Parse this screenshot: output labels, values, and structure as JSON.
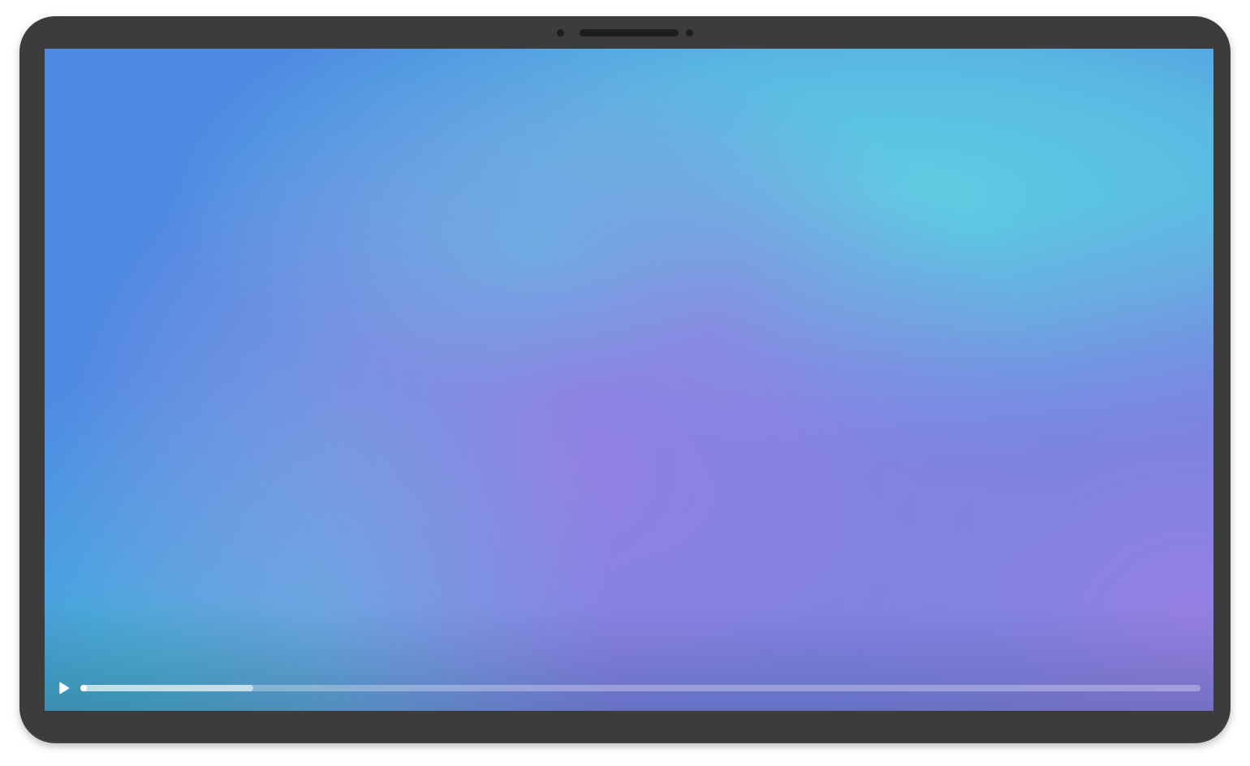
{
  "device": {
    "frame_color": "#3c3c3c",
    "sensor_color": "#1e1e1e"
  },
  "wallpaper": {
    "colors": [
      "#5089e2",
      "#5ecee2",
      "#9680e2",
      "#48b0e0"
    ]
  },
  "player": {
    "play_icon": "play-icon",
    "progress_fraction": 0.154,
    "buffered_color": "#ffffff",
    "track_color": "#ffffff"
  }
}
